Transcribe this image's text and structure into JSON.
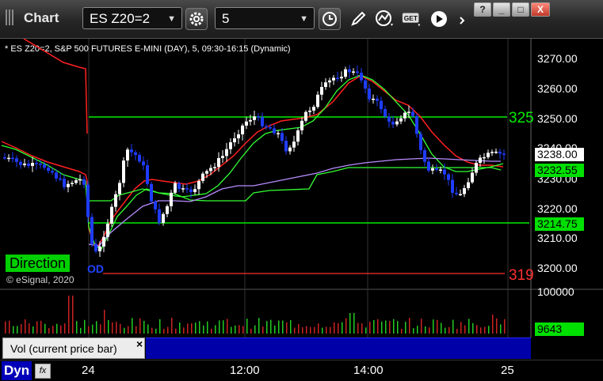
{
  "toolbar": {
    "app_title": "Chart",
    "symbol_value": "ES Z20=2",
    "interval_value": "5"
  },
  "window_controls": {
    "help": "?",
    "minimize": "_",
    "maximize": "□",
    "close": "X"
  },
  "chart": {
    "title": "* ES Z20=2, S&P 500 FUTURES E-MINI (DAY), 5, 09:30-16:15 (Dynamic)",
    "copyright": "© eSignal, 2020",
    "direction_label": "Direction",
    "direction_sub": "OD",
    "price_ticks": [
      "3270.00",
      "3260.00",
      "3250.00",
      "3240.00",
      "3230.00",
      "3220.00",
      "3210.00",
      "3200.00"
    ],
    "volume_ticks": [
      "100000"
    ],
    "current_price": "3238.00",
    "ma_price": "3232.55",
    "support_price": "3214.75",
    "current_volume": "9643",
    "level_label_upper": "325",
    "level_label_lower": "319",
    "time_labels": [
      "24",
      "12:00",
      "14:00",
      "25"
    ],
    "volume_study_label": "Vol (current price bar)",
    "volume_close": "×",
    "dyn_label": "Dyn",
    "fx_label": "fx",
    "colors": {
      "up_candle": "#ffffff",
      "down_candle": "#1f3cff",
      "level_line": "#00ee00",
      "lower_level": "#ff3030",
      "ma_red": "#ff2020",
      "ma_green": "#33ff33",
      "ma_purple": "#b98cff"
    }
  }
}
